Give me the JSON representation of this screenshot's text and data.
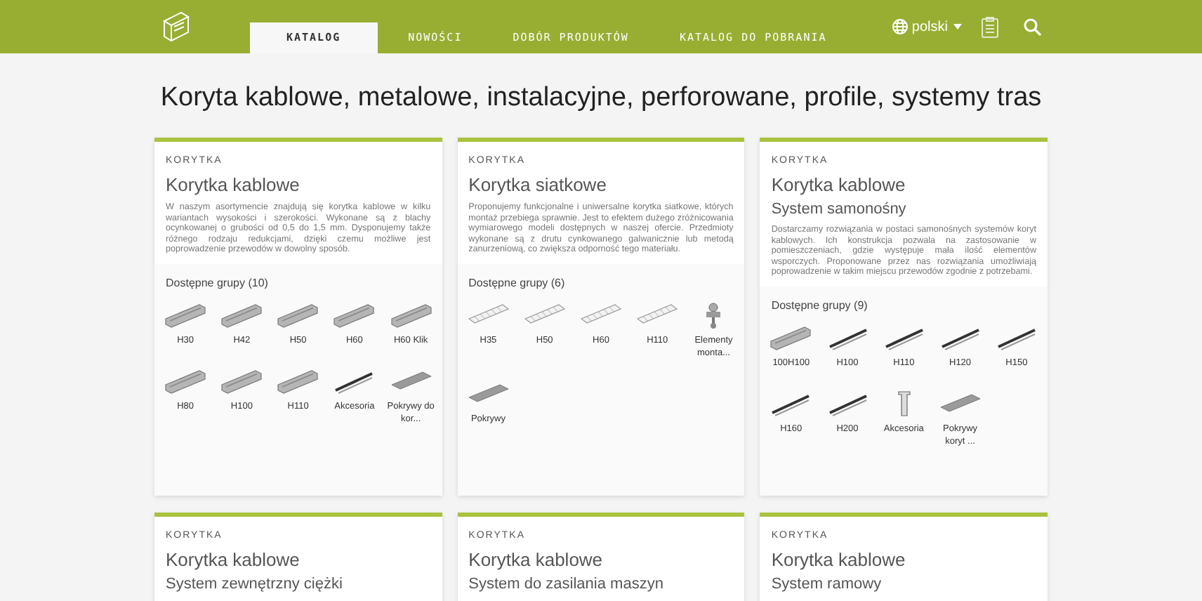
{
  "nav": {
    "tabs": [
      {
        "label": "KATALOG",
        "selected": true
      },
      {
        "label": "NOWOŚCI",
        "selected": false
      },
      {
        "label": "DOBÓR PRODUKTÓW",
        "selected": false
      },
      {
        "label": "KATALOG DO POBRANIA",
        "selected": false
      }
    ],
    "language": "polski"
  },
  "heading": "Koryta kablowe, metalowe, instalacyjne, perforowane, profile, systemy tras",
  "cards": [
    {
      "category": "KORYTKA",
      "title": "Korytka kablowe",
      "description": "W naszym asortymencie znajdują się korytka kablowe w kilku wariantach wysokości i szerokości. Wykonane są z blachy ocynkowanej o grubości od 0,5 do 1,5 mm. Dysponujemy także różnego rodzaju redukcjami, dzięki czemu możliwe jest poprowadzenie przewodów w dowolny sposób.",
      "groups_label": "Dostępne grupy (10)",
      "groups": [
        {
          "label": "H30",
          "kind": "tray"
        },
        {
          "label": "H42",
          "kind": "tray"
        },
        {
          "label": "H50",
          "kind": "tray"
        },
        {
          "label": "H60",
          "kind": "tray"
        },
        {
          "label": "H60 Klik",
          "kind": "tray"
        },
        {
          "label": "H80",
          "kind": "tray"
        },
        {
          "label": "H100",
          "kind": "tray"
        },
        {
          "label": "H110",
          "kind": "tray"
        },
        {
          "label": "Akcesoria",
          "kind": "rail"
        },
        {
          "label": "Pokrywy do kor...",
          "kind": "cover"
        }
      ]
    },
    {
      "category": "KORYTKA",
      "title": "Korytka siatkowe",
      "description": "Proponujemy funkcjonalne i uniwersalne korytka siatkowe, których montaż przebiega sprawnie. Jest to efektem dużego zróżnicowania wymiarowego modeli dostępnych w naszej ofercie. Przedmioty wykonane są z drutu cynkowanego galwanicznie lub metodą zanurzeniową, co zwiększa odporność tego materiału.",
      "groups_label": "Dostępne grupy (6)",
      "groups": [
        {
          "label": "H35",
          "kind": "mesh"
        },
        {
          "label": "H50",
          "kind": "mesh"
        },
        {
          "label": "H60",
          "kind": "mesh"
        },
        {
          "label": "H110",
          "kind": "mesh"
        },
        {
          "label": "Elementy monta...",
          "kind": "fitting"
        },
        {
          "label": "Pokrywy",
          "kind": "cover"
        }
      ]
    },
    {
      "category": "KORYTKA",
      "title": "Korytka kablowe",
      "subtitle": "System samonośny",
      "description": "Dostarczamy rozwiązania w postaci samonośnych systemów koryt kablowych. Ich konstrukcja pozwala na zastosowanie w pomieszczeniach, gdzie występuje mała ilość elementów wsporczych. Proponowane przez nas rozwiązania umożliwiają poprowadzenie w takim miejscu przewodów zgodnie z potrzebami.",
      "groups_label": "Dostępne grupy (9)",
      "groups": [
        {
          "label": "100H100",
          "kind": "tray"
        },
        {
          "label": "H100",
          "kind": "rail"
        },
        {
          "label": "H110",
          "kind": "rail"
        },
        {
          "label": "H120",
          "kind": "rail"
        },
        {
          "label": "H150",
          "kind": "rail"
        },
        {
          "label": "H160",
          "kind": "rail"
        },
        {
          "label": "H200",
          "kind": "rail"
        },
        {
          "label": "Akcesoria",
          "kind": "bracket"
        },
        {
          "label": "Pokrywy koryt ...",
          "kind": "cover"
        }
      ]
    },
    {
      "category": "KORYTKA",
      "title": "Korytka kablowe",
      "subtitle": "System zewnętrzny ciężki"
    },
    {
      "category": "KORYTKA",
      "title": "Korytka kablowe",
      "subtitle": "System do zasilania maszyn"
    },
    {
      "category": "KORYTKA",
      "title": "Korytka kablowe",
      "subtitle": "System ramowy"
    }
  ]
}
